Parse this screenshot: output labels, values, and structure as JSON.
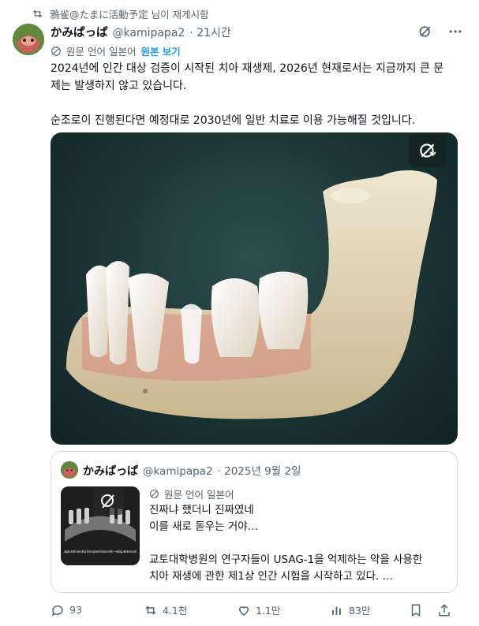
{
  "repost": {
    "text": "鴉雀@たまに活動予定 님이 재게시함",
    "icon": "repost-icon"
  },
  "author": {
    "name": "かみぱっぱ",
    "handle": "@kamipapa2",
    "time": "· 21시간"
  },
  "translation": {
    "label": "원문 언어 일본어",
    "link": "원본 보기"
  },
  "body": {
    "p1": "2024년에 인간 대상 검증이 시작된 치아 재생제, 2026년 현재로서는 지금까지 큰 문\n제는 발생하지 않고 있습니다.",
    "p2": "순조로이 진행된다면 예정대로 2030년에 일반 치료로 이용 가능해질 것입니다."
  },
  "quote": {
    "name": "かみぱっぱ",
    "handle": "@kamipapa2",
    "date": "· 2025년 9월 2일",
    "translation": "원문 언어 일본어",
    "thumb_caption": "Japan trials new drug that regrows human teeth – ending dentures and",
    "text1": "진짜냐 했더니 진짜였네\n이를 새로 돋우는 거야…",
    "text2": "교토대학병원의 연구자들이 USAG-1을 억제하는 약을 사용한\n치아 재생에 관한 제1상 인간 시험을 시작하고 있다. …"
  },
  "actions": {
    "replies": "93",
    "reposts": "4.1천",
    "likes": "1.1만",
    "views": "83만"
  },
  "colors": {
    "accent": "#1d9bf0",
    "muted": "#536471",
    "text": "#0f1419",
    "border": "#cfd9de"
  }
}
